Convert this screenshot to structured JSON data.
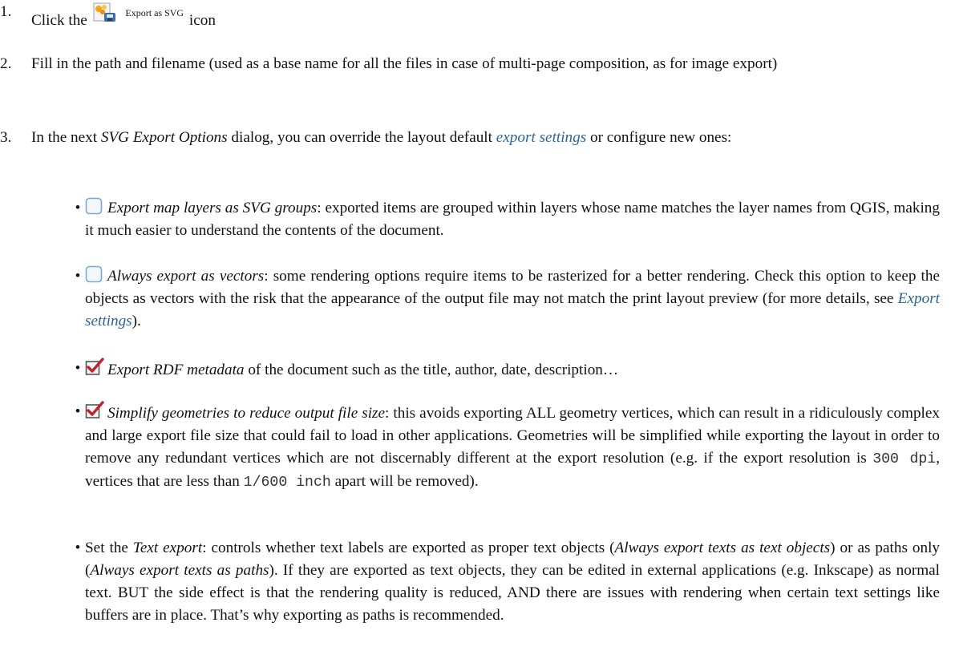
{
  "steps": [
    {
      "number": "1.",
      "pre": "Click the",
      "icon": "export-svg-icon",
      "icon_caption": "Export as SVG",
      "post": "icon"
    },
    {
      "number": "2.",
      "text": "Fill in the path and filename (used as a base name for all the files in case of multi-page composition, as for image export)"
    },
    {
      "number": "3.",
      "pre": "In the next",
      "dialog_name": "SVG Export Options",
      "mid": "dialog, you can override the layout default",
      "link": "export settings",
      "post": "or configure new ones:"
    }
  ],
  "options": [
    {
      "checked": false,
      "label": "Export map layers as SVG groups",
      "desc": ": exported items are grouped within layers whose name matches the layer names from QGIS, making it much easier to understand the contents of the document."
    },
    {
      "checked": false,
      "label": "Always export as vectors",
      "desc": ": some rendering options require items to be rasterized for a better rendering. Check this option to keep the objects as vectors with the risk that the appearance of the output file may not match the print layout preview (for more details, see",
      "link": "Export settings",
      "desc_end": ")."
    },
    {
      "checked": true,
      "label": "Export RDF metadata",
      "desc": " of the document such as the title, author, date, description…"
    },
    {
      "checked": true,
      "label": "Simplify geometries to reduce output file size",
      "desc_a": ": this avoids exporting ALL geometry vertices, which can result in a ridiculously complex and large export file size that could fail to load in other applications. Geometries will be simplified while exporting the layout in order to remove any redundant vertices which are not discernably different at the export resolution (e.g. if the export resolution is",
      "code_a": "300 dpi",
      "desc_b": ", vertices that are less than",
      "code_b": "1/600 inch",
      "desc_c": "apart will be removed)."
    },
    {
      "pre": "Set the",
      "label": "Text export",
      "desc_a": ": controls whether text labels are exported as proper text objects (",
      "opt1": "Always export texts as text objects",
      "desc_b": ") or as paths only (",
      "opt2": "Always export texts as paths",
      "desc_c": "). If they are exported as text objects, they can be edited in external applications (e.g. Inkscape) as normal text. BUT the side effect is that the rendering quality is reduced, AND there are issues with rendering when certain text settings like buffers are in place. That’s why exporting as paths is recommended."
    },
    {
      "bullet_char": "•"
    }
  ],
  "colors": {
    "link": "#2a6496",
    "check_red": "#c0242a",
    "checkbox_border": "#7aa7d6"
  }
}
